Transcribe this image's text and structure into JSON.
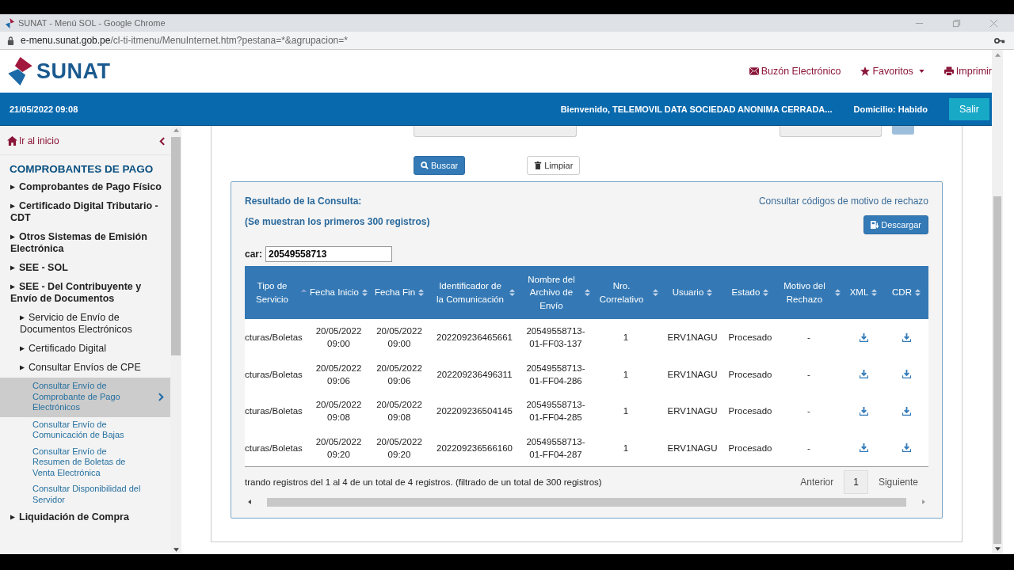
{
  "browser": {
    "title": "SUNAT - Menú SOL - Google Chrome",
    "url_host": "e-menu.sunat.gob.pe",
    "url_path": "/cl-ti-itmenu/MenuInternet.htm?pestana=*&agrupacion=*"
  },
  "header": {
    "logo": "SUNAT",
    "links": [
      {
        "kind": "mail",
        "label": "Buzón Electrónico"
      },
      {
        "kind": "favorites",
        "label": "Favoritos"
      },
      {
        "kind": "print",
        "label": "Imprimir"
      }
    ]
  },
  "topbar": {
    "datetime": "21/05/2022 09:08",
    "welcome": "Bienvenido, TELEMOVIL DATA SOCIEDAD ANONIMA CERRADA...",
    "domicilio": "Domicilio: Habido",
    "logout": "Salir"
  },
  "sidebar": {
    "home": "Ir al inicio",
    "section": "COMPROBANTES DE PAGO",
    "items": [
      {
        "label": "Comprobantes de Pago Físico"
      },
      {
        "label": "Certificado Digital Tributario - CDT"
      },
      {
        "label": "Otros Sistemas de Emisión Electrónica"
      },
      {
        "label": "SEE - SOL"
      },
      {
        "label": "SEE - Del Contribuyente y Envío de Documentos",
        "children": [
          {
            "label": "Servicio de Envío de Documentos Electrónicos"
          },
          {
            "label": "Certificado Digital"
          },
          {
            "label": "Consultar Envíos de CPE",
            "children": [
              {
                "label": "Consultar Envío de Comprobante de Pago Electrónicos",
                "selected": true
              },
              {
                "label": "Consultar Envío de Comunicación de Bajas",
                "selected": false
              },
              {
                "label": "Consultar Envío de Resumen de Boletas de Venta Electrónica",
                "selected": false
              },
              {
                "label": "Consultar Disponibilidad del Servidor",
                "selected": false
              }
            ]
          }
        ]
      },
      {
        "label": "Liquidación de Compra"
      }
    ]
  },
  "form": {
    "search_button": "Buscar",
    "clear_button": "Limpiar"
  },
  "results": {
    "title": "Resultado de la Consulta:",
    "subtitle": "(Se muestran los primeros 300 registros)",
    "codes_link": "Consultar códigos de motivo de rechazo",
    "download_button": "Descargar",
    "filter_label": "car:",
    "filter_value": "20549558713",
    "columns": [
      {
        "label": "Tipo de Servicio",
        "kind": "text",
        "sorted": true
      },
      {
        "label": "Fecha Inicio",
        "kind": "text",
        "sorted": false
      },
      {
        "label": "Fecha Fin",
        "kind": "text",
        "sorted": false
      },
      {
        "label": "Identificador de la Comunicación",
        "kind": "text",
        "sorted": false
      },
      {
        "label": "Nombre del Archivo de Envío",
        "kind": "text",
        "sorted": false
      },
      {
        "label": "Nro. Correlativo",
        "kind": "text",
        "sorted": false
      },
      {
        "label": "Usuario",
        "kind": "text",
        "sorted": false
      },
      {
        "label": "Estado",
        "kind": "text",
        "sorted": false
      },
      {
        "label": "Motivo del Rechazo",
        "kind": "text",
        "sorted": false
      },
      {
        "label": "XML",
        "kind": "download",
        "sorted": false
      },
      {
        "label": "CDR",
        "kind": "download",
        "sorted": false
      }
    ],
    "rows": [
      [
        "cturas/Boletas",
        "20/05/2022 09:00",
        "20/05/2022 09:00",
        "202209236465661",
        "20549558713-01-FF03-137",
        "1",
        "ERV1NAGU",
        "Procesado",
        "-"
      ],
      [
        "cturas/Boletas",
        "20/05/2022 09:06",
        "20/05/2022 09:06",
        "202209236496311",
        "20549558713-01-FF04-286",
        "1",
        "ERV1NAGU",
        "Procesado",
        "-"
      ],
      [
        "cturas/Boletas",
        "20/05/2022 09:08",
        "20/05/2022 09:08",
        "202209236504145",
        "20549558713-01-FF04-285",
        "1",
        "ERV1NAGU",
        "Procesado",
        "-"
      ],
      [
        "cturas/Boletas",
        "20/05/2022 09:20",
        "20/05/2022 09:20",
        "202209236566160",
        "20549558713-01-FF04-287",
        "1",
        "ERV1NAGU",
        "Procesado",
        "-"
      ]
    ],
    "info": "trando registros del 1 al 4 de un total de 4 registros. (filtrado de un total de 300 registros)",
    "pagination": {
      "previous": "Anterior",
      "pages": [
        {
          "label": "1",
          "selected": true
        }
      ],
      "next": "Siguiente"
    }
  }
}
